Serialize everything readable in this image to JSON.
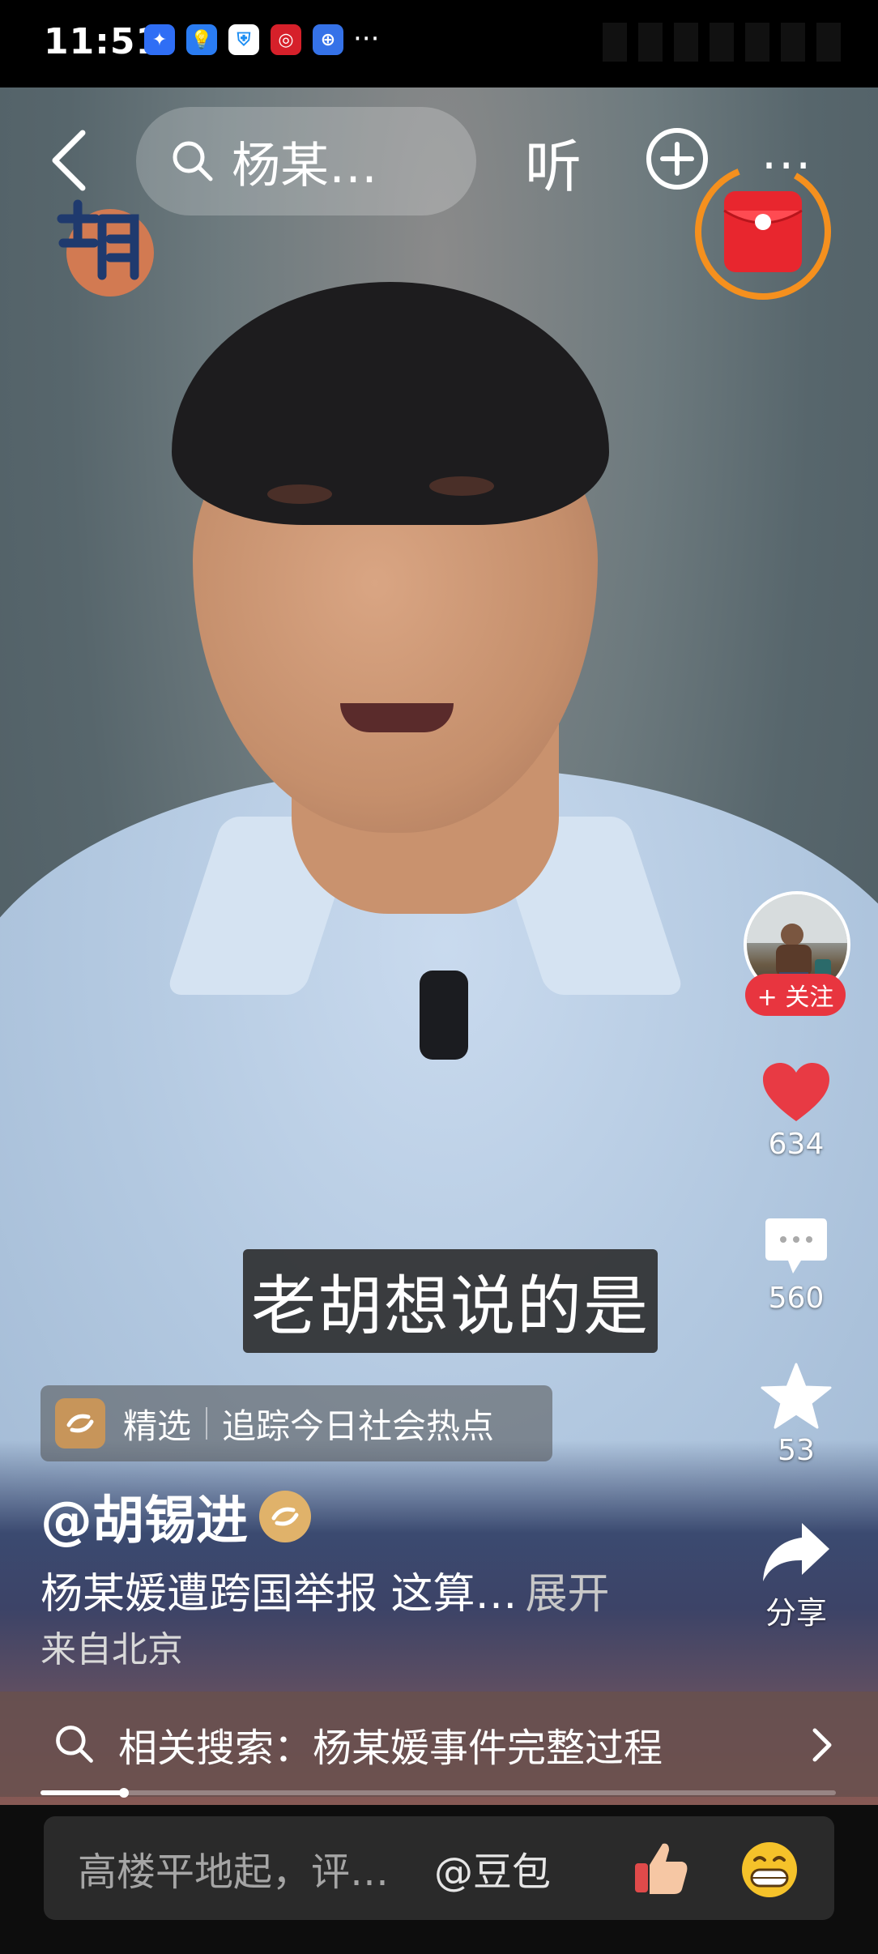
{
  "status_bar": {
    "time": "11:51",
    "more": "···",
    "icons": [
      "app-icon-blue",
      "bulb-icon",
      "shield-icon",
      "app-icon-red",
      "globe-icon"
    ]
  },
  "top_bar": {
    "search_text": "杨某…",
    "listen_label": "听",
    "more_label": "···"
  },
  "video": {
    "subtitle": "老胡想说的是"
  },
  "side_actions": {
    "follow_label": "+ 关注",
    "likes": "634",
    "comments": "560",
    "favorites": "53",
    "share_label": "分享"
  },
  "tag": {
    "label": "精选",
    "topic": "追踪今日社会热点"
  },
  "post": {
    "author": "@胡锡进",
    "description": "杨某媛遭跨国举报 这算…",
    "expand_label": "展开",
    "origin": "来自北京"
  },
  "related_search": {
    "label": "相关搜索：杨某媛事件完整过程"
  },
  "progress": {
    "fraction": 0.105
  },
  "comment_bar": {
    "placeholder": "高楼平地起，评…",
    "mention": "@豆包"
  },
  "colors": {
    "follow_red": "#e8353f",
    "like_red": "#e83a44",
    "redpacket_ring": "#f5901e"
  }
}
